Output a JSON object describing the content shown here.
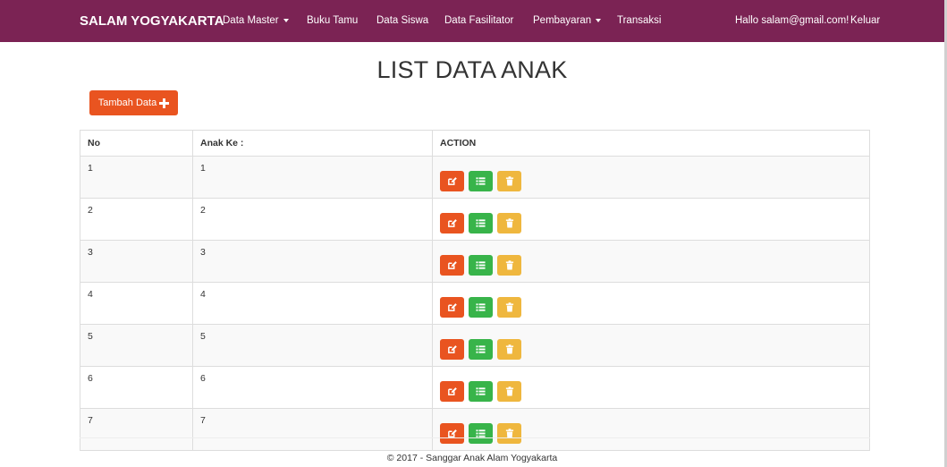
{
  "navbar": {
    "brand": "SALAM YOGYAKARTA",
    "items": [
      {
        "label": "Data Master",
        "dropdown": true
      },
      {
        "label": "Buku Tamu",
        "dropdown": false
      },
      {
        "label": "Data Siswa",
        "dropdown": false
      },
      {
        "label": "Data Fasilitator",
        "dropdown": false
      },
      {
        "label": "Pembayaran",
        "dropdown": true
      },
      {
        "label": "Transaksi",
        "dropdown": false
      }
    ],
    "greeting": "Hallo salam@gmail.com!",
    "logout": "Keluar"
  },
  "page": {
    "title": "LIST DATA ANAK",
    "add_button": "Tambah Data"
  },
  "table": {
    "headers": [
      "No",
      "Anak Ke :",
      "ACTION"
    ],
    "rows": [
      {
        "no": "1",
        "anak_ke": "1"
      },
      {
        "no": "2",
        "anak_ke": "2"
      },
      {
        "no": "3",
        "anak_ke": "3"
      },
      {
        "no": "4",
        "anak_ke": "4"
      },
      {
        "no": "5",
        "anak_ke": "5"
      },
      {
        "no": "6",
        "anak_ke": "6"
      },
      {
        "no": "7",
        "anak_ke": "7"
      }
    ],
    "action_icons": [
      "edit-icon",
      "list-icon",
      "trash-icon"
    ]
  },
  "footer": {
    "text": "© 2017 - Sanggar Anak Alam Yogyakarta"
  },
  "colors": {
    "navbar": "#7b2354",
    "primary": "#e95420",
    "success": "#38b44a",
    "warning": "#efb73e"
  }
}
